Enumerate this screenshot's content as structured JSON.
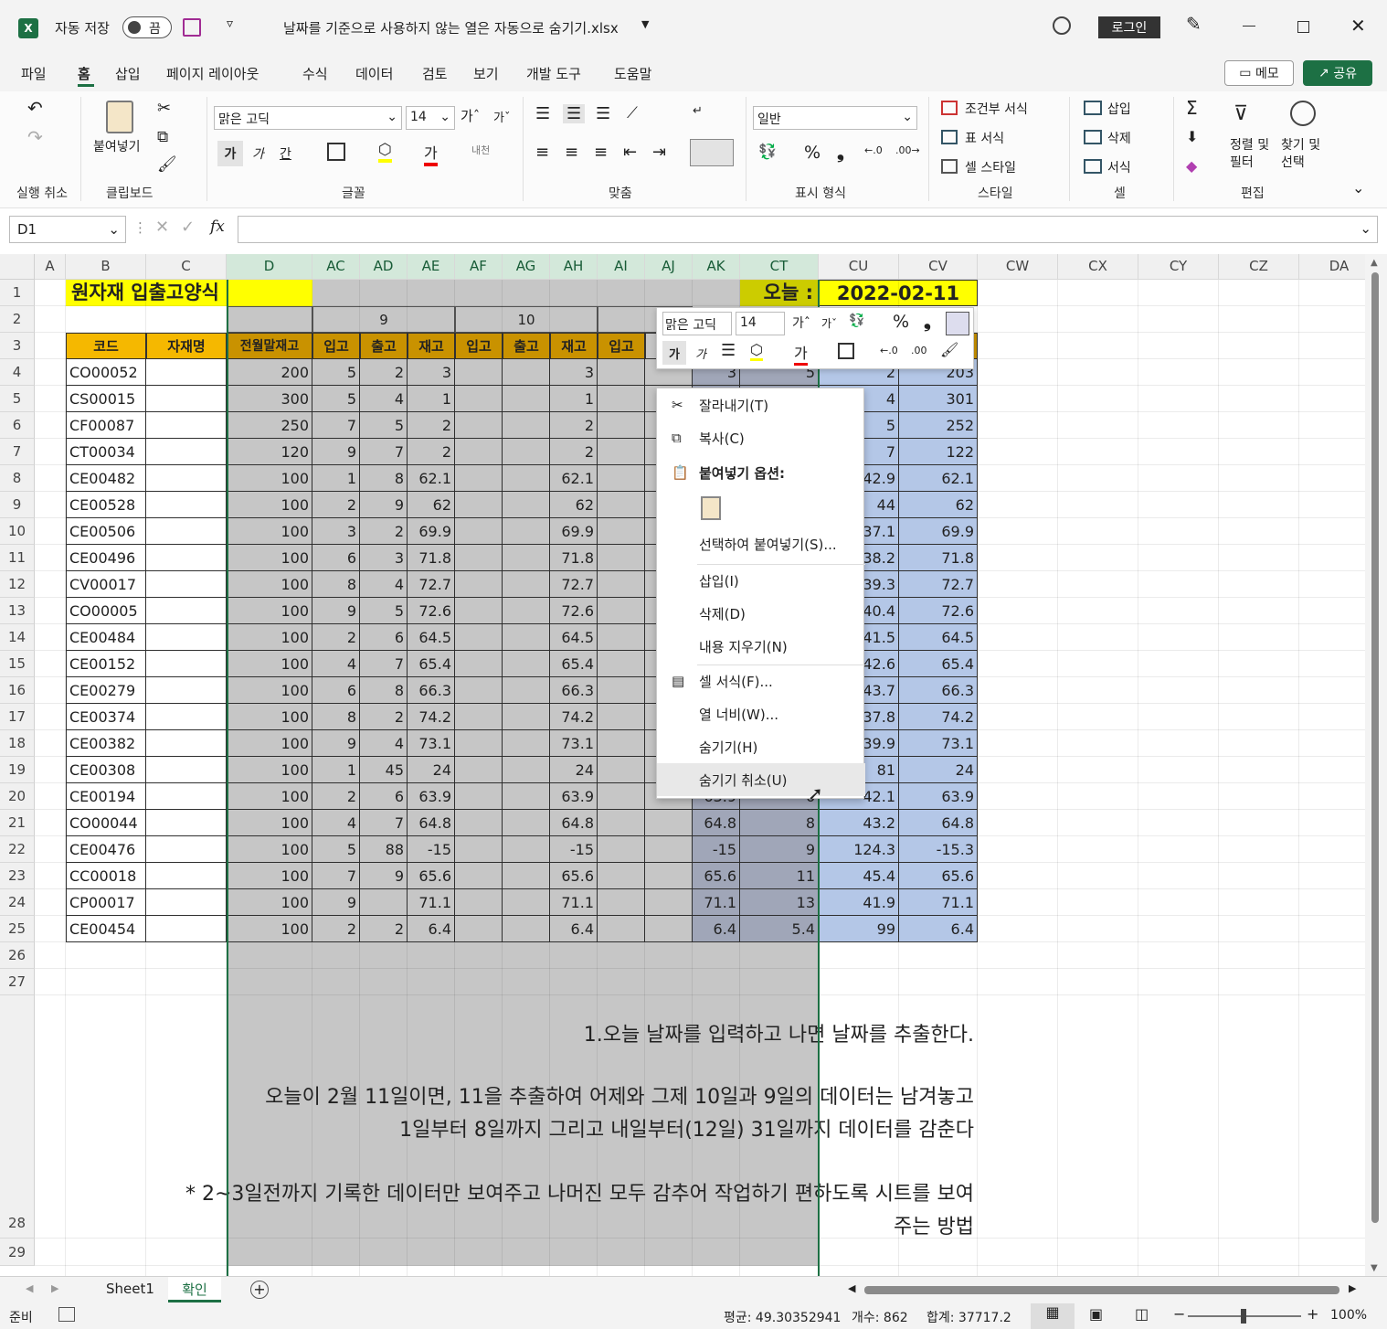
{
  "titlebar": {
    "autosave": "자동 저장",
    "toggle": "끔",
    "filename": "날짜를 기준으로 사용하지 않는 열은 자동으로 숨기기.xlsx",
    "login": "로그인"
  },
  "menu": {
    "items": [
      "파일",
      "홈",
      "삽입",
      "페이지 레이아웃",
      "수식",
      "데이터",
      "검토",
      "보기",
      "개발 도구",
      "도움말"
    ],
    "memo": "메모",
    "share": "공유"
  },
  "ribbon": {
    "undo_group": "실행 취소",
    "paste": "붙여넣기",
    "clipboard": "클립보드",
    "font_name": "맑은 고딕",
    "font_size": "14",
    "font_group": "글꼴",
    "align_group": "맞춤",
    "number_format": "일반",
    "number_group": "표시 형식",
    "cond_format": "조건부 서식",
    "table_format": "표 서식",
    "cell_style": "셀 스타일",
    "style_group": "스타일",
    "insert": "삽입",
    "delete": "삭제",
    "format": "서식",
    "cells_group": "셀",
    "sort_filter": "정렬 및\n필터",
    "find_select": "찾기 및\n선택",
    "edit_group": "편집"
  },
  "formula": {
    "namebox": "D1",
    "fx": "fx",
    "value": ""
  },
  "columns": [
    "A",
    "B",
    "C",
    "D",
    "AC",
    "AD",
    "AE",
    "AF",
    "AG",
    "AH",
    "AI",
    "AJ",
    "AK",
    "CT",
    "CU",
    "CV",
    "CW",
    "CX",
    "CY",
    "CZ",
    "DA"
  ],
  "sheet": {
    "title": "원자재 입출고양식",
    "today_label": "오늘 :",
    "today_value": "2022-02-11",
    "group9": "9",
    "group10": "10",
    "headers": [
      "코드",
      "자재명",
      "전월말재고",
      "입고",
      "출고",
      "재고",
      "입고",
      "출고",
      "재고",
      "입고"
    ],
    "rows": [
      [
        "CO00052",
        "200",
        "5",
        "2",
        "3",
        "3",
        "3",
        "5",
        "2",
        "203"
      ],
      [
        "CS00015",
        "300",
        "5",
        "4",
        "1",
        "1",
        "",
        "",
        "4",
        "301"
      ],
      [
        "CF00087",
        "250",
        "7",
        "5",
        "2",
        "2",
        "",
        "",
        "5",
        "252"
      ],
      [
        "CT00034",
        "120",
        "9",
        "7",
        "2",
        "2",
        "",
        "",
        "7",
        "122"
      ],
      [
        "CE00482",
        "100",
        "1",
        "8",
        "62.1",
        "62.1",
        "",
        "",
        "42.9",
        "62.1"
      ],
      [
        "CE00528",
        "100",
        "2",
        "9",
        "62",
        "62",
        "",
        "",
        "44",
        "62"
      ],
      [
        "CE00506",
        "100",
        "3",
        "2",
        "69.9",
        "69.9",
        "",
        "",
        "37.1",
        "69.9"
      ],
      [
        "CE00496",
        "100",
        "6",
        "3",
        "71.8",
        "71.8",
        "",
        "",
        "38.2",
        "71.8"
      ],
      [
        "CV00017",
        "100",
        "8",
        "4",
        "72.7",
        "72.7",
        "",
        "",
        "39.3",
        "72.7"
      ],
      [
        "CO00005",
        "100",
        "9",
        "5",
        "72.6",
        "72.6",
        "",
        "",
        "40.4",
        "72.6"
      ],
      [
        "CE00484",
        "100",
        "2",
        "6",
        "64.5",
        "64.5",
        "",
        "",
        "41.5",
        "64.5"
      ],
      [
        "CE00152",
        "100",
        "4",
        "7",
        "65.4",
        "65.4",
        "",
        "",
        "42.6",
        "65.4"
      ],
      [
        "CE00279",
        "100",
        "6",
        "8",
        "66.3",
        "66.3",
        "",
        "",
        "43.7",
        "66.3"
      ],
      [
        "CE00374",
        "100",
        "8",
        "2",
        "74.2",
        "74.2",
        "",
        "",
        "37.8",
        "74.2"
      ],
      [
        "CE00382",
        "100",
        "9",
        "4",
        "73.1",
        "73.1",
        "",
        "",
        "39.9",
        "73.1"
      ],
      [
        "CE00308",
        "100",
        "1",
        "45",
        "24",
        "24",
        "",
        "",
        "81",
        "24"
      ],
      [
        "CE00194",
        "100",
        "2",
        "6",
        "63.9",
        "63.9",
        "63.9",
        "6",
        "42.1",
        "63.9"
      ],
      [
        "CO00044",
        "100",
        "4",
        "7",
        "64.8",
        "64.8",
        "64.8",
        "8",
        "43.2",
        "64.8"
      ],
      [
        "CE00476",
        "100",
        "5",
        "88",
        "-15",
        "-15",
        "-15",
        "9",
        "124.3",
        "-15.3"
      ],
      [
        "CC00018",
        "100",
        "7",
        "9",
        "65.6",
        "65.6",
        "65.6",
        "11",
        "45.4",
        "65.6"
      ],
      [
        "CP00017",
        "100",
        "9",
        "",
        "71.1",
        "71.1",
        "71.1",
        "13",
        "41.9",
        "71.1"
      ],
      [
        "CE00454",
        "100",
        "2",
        "2",
        "6.4",
        "6.4",
        "6.4",
        "5.4",
        "99",
        "6.4"
      ]
    ],
    "note1": "1.오늘 날짜를 입력하고 나면 날짜를 추출한다.",
    "note2": "오늘이 2월 11일이면,  11을 추출하여 어제와 그제 10일과 9일의 데이터는 남겨놓고",
    "note3": "1일부터 8일까지 그리고 내일부터(12일) 31일까지 데이터를 감춘다",
    "note4": "* 2~3일전까지 기록한 데이터만 보여주고 나머진 모두 감추어 작업하기 편하도록 시트를 보여",
    "note5": "주는 방법"
  },
  "minitoolbar": {
    "font": "맑은 고딕",
    "size": "14"
  },
  "context_menu": {
    "cut": "잘라내기(T)",
    "copy": "복사(C)",
    "paste_options": "붙여넣기 옵션:",
    "paste_special": "선택하여 붙여넣기(S)...",
    "insert": "삽입(I)",
    "delete": "삭제(D)",
    "clear": "내용 지우기(N)",
    "format_cells": "셀 서식(F)...",
    "col_width": "열 너비(W)...",
    "hide": "숨기기(H)",
    "unhide": "숨기기 취소(U)"
  },
  "tabs": {
    "sheet1": "Sheet1",
    "active": "확인"
  },
  "status": {
    "ready": "준비",
    "avg": "평균: 49.30352941",
    "count": "개수: 862",
    "sum": "합계: 37717.2",
    "zoom": "100%"
  }
}
